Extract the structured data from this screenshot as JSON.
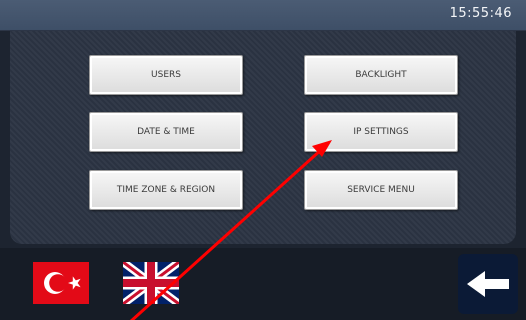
{
  "status_bar": {
    "time": "15:55:46"
  },
  "menu": {
    "users": "USERS",
    "date_time": "DATE & TIME",
    "time_zone_region": "TIME ZONE & REGION",
    "backlight": "BACKLIGHT",
    "ip_settings": "IP SETTINGS",
    "service_menu": "SERVICE MENU"
  },
  "languages": [
    "turkish-flag",
    "uk-flag"
  ],
  "icons": {
    "back": "left-arrow-icon",
    "annotation": "red-pointer-arrow"
  },
  "colors": {
    "turkish_red": "#e30a17",
    "uk_blue": "#012169",
    "uk_red": "#c8102e",
    "annotation_red": "#ff0000",
    "back_button_bg": "#0b1a36"
  }
}
